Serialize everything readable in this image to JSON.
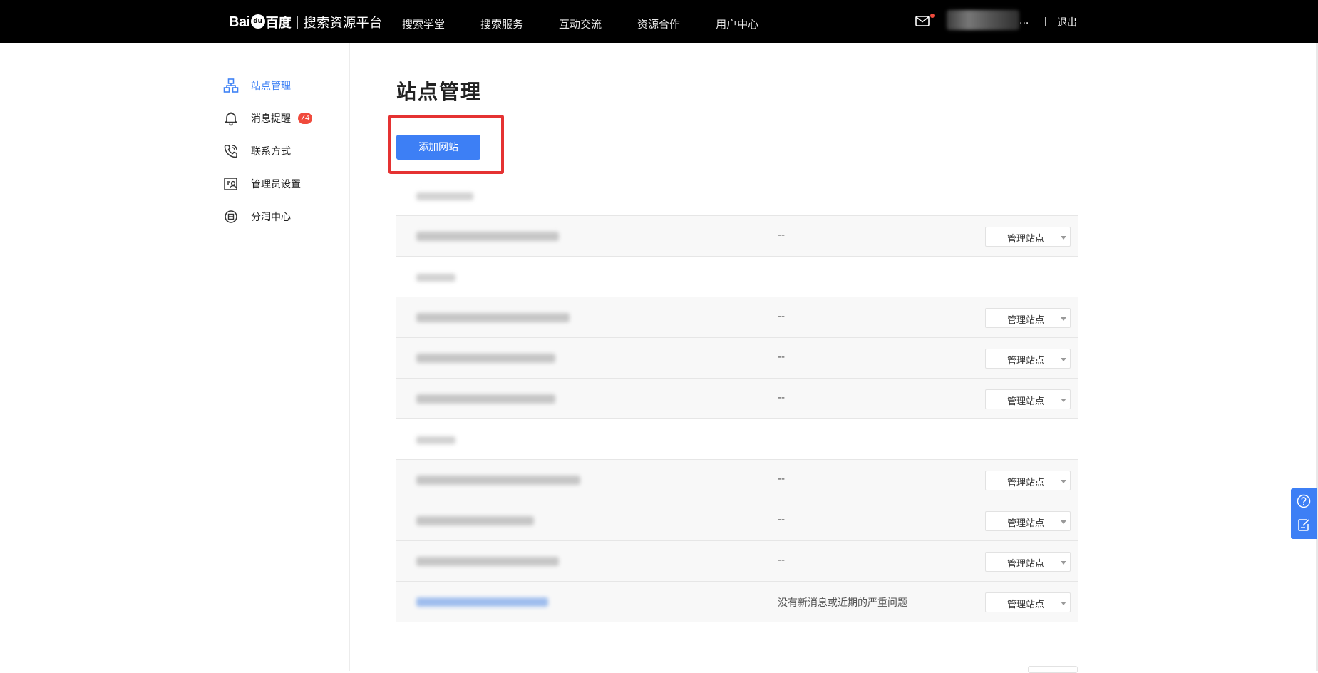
{
  "header": {
    "logo": {
      "bai": "Bai",
      "paw": "du",
      "baidu": "百度",
      "product": "搜索资源平台"
    },
    "nav": [
      "搜索学堂",
      "搜索服务",
      "互动交流",
      "资源合作",
      "用户中心"
    ],
    "user_name_tail": "...",
    "logout_label": "退出"
  },
  "sidebar": {
    "items": [
      {
        "label": "站点管理",
        "icon": "sitemap-icon",
        "active": true
      },
      {
        "label": "消息提醒",
        "icon": "bell-icon",
        "badge": "74"
      },
      {
        "label": "联系方式",
        "icon": "phone-icon"
      },
      {
        "label": "管理员设置",
        "icon": "admin-card-icon"
      },
      {
        "label": "分润中心",
        "icon": "revenue-icon"
      }
    ]
  },
  "main": {
    "title": "站点管理",
    "add_button": "添加网站",
    "manage_label": "管理站点",
    "rows": [
      {
        "type": "group"
      },
      {
        "type": "site",
        "status": "--"
      },
      {
        "type": "group"
      },
      {
        "type": "site",
        "status": "--"
      },
      {
        "type": "site",
        "status": "--"
      },
      {
        "type": "site",
        "status": "--"
      },
      {
        "type": "group"
      },
      {
        "type": "site",
        "status": "--"
      },
      {
        "type": "site",
        "status": "--"
      },
      {
        "type": "site",
        "status": "--"
      },
      {
        "type": "site",
        "status": "没有新消息或近期的严重问题",
        "link": true
      }
    ]
  },
  "colors": {
    "accent": "#3d7ff5",
    "highlight": "#e53232",
    "badge": "#f04a3c",
    "topbar": "#000000"
  },
  "float_tools": [
    "help-icon",
    "feedback-icon"
  ]
}
